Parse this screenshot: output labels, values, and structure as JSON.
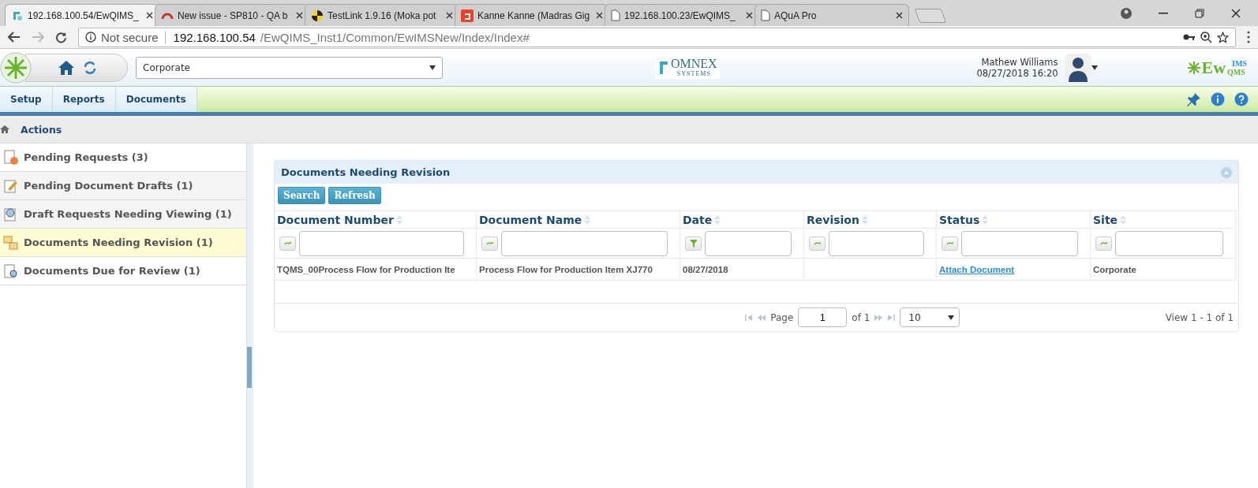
{
  "browser": {
    "tabs": [
      {
        "title": "192.168.100.54/EwQIMS_",
        "selected": true
      },
      {
        "title": "New issue - SP810 - QA b",
        "selected": false
      },
      {
        "title": "TestLink 1.9.16 (Moka pot",
        "selected": false
      },
      {
        "title": "Kanne Kanne (Madras Gig",
        "selected": false
      },
      {
        "title": "192.168.100.23/EwQIMS_",
        "selected": false
      },
      {
        "title": "AQuA Pro",
        "selected": false
      }
    ],
    "security": "Not secure",
    "url_host": "192.168.100.54",
    "url_path": "/EwQIMS_Inst1/Common/EwIMSNew/Index/Index#"
  },
  "header": {
    "site_select": "Corporate",
    "omnex_logo": {
      "name": "OMNEX",
      "tagline": "SYSTEMS"
    },
    "user_name": "Mathew Williams",
    "datetime": "08/27/2018 16:20",
    "product_logo": {
      "main": "Ew",
      "top": "IMS",
      "bottom": "QMS"
    }
  },
  "menu": [
    "Setup",
    "Reports",
    "Documents"
  ],
  "breadcrumb": "Actions",
  "sidebar": {
    "items": [
      {
        "label": "Pending Requests (3)",
        "selected": false
      },
      {
        "label": "Pending Document Drafts (1)",
        "selected": false
      },
      {
        "label": "Draft Requests Needing Viewing (1)",
        "selected": false
      },
      {
        "label": "Documents Needing Revision (1)",
        "selected": true
      },
      {
        "label": "Documents Due for Review (1)",
        "selected": false
      }
    ]
  },
  "panel": {
    "title": "Documents Needing Revision",
    "buttons": [
      "Search",
      "Refresh"
    ],
    "columns": [
      {
        "label": "Document Number",
        "kind": "text"
      },
      {
        "label": "Document Name",
        "kind": "text"
      },
      {
        "label": "Date",
        "kind": "date"
      },
      {
        "label": "Revision",
        "kind": "text"
      },
      {
        "label": "Status",
        "kind": "text"
      },
      {
        "label": "Site",
        "kind": "text"
      }
    ],
    "rows": [
      [
        {
          "kind": "text",
          "text": "TQMS_00Process Flow for Production Ite"
        },
        {
          "kind": "text",
          "text": "Process Flow for Production Item XJ770"
        },
        {
          "kind": "text",
          "text": "08/27/2018"
        },
        {
          "kind": "empty"
        },
        {
          "kind": "link",
          "text": "Attach Document"
        },
        {
          "kind": "text",
          "text": "Corporate"
        }
      ]
    ],
    "pager": {
      "page_label": "Page",
      "page": "1",
      "of": "of 1",
      "page_size": "10",
      "summary": "View 1 - 1 of 1"
    }
  }
}
